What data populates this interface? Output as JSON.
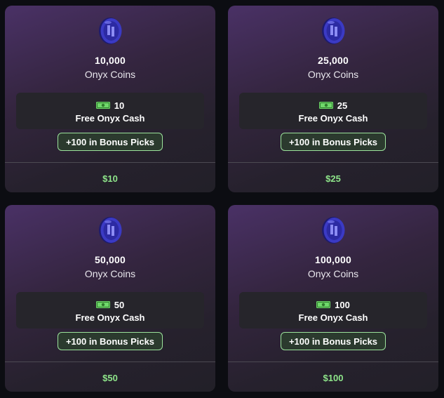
{
  "colors": {
    "background": "#0c0d12",
    "card_gradient_top": "#4a3166",
    "card_gradient_bottom": "#222028",
    "price_green": "#8ee58a",
    "pill_border": "#9ce39c",
    "coin_blue": "#3b3ac4"
  },
  "icons": {
    "coin": "onyx-coin-icon",
    "cash": "cash-bill-icon"
  },
  "packages": [
    {
      "amount": "10,000",
      "unit": "Onyx Coins",
      "cash_amount": "10",
      "cash_label": "Free Onyx Cash",
      "bonus_picks": "+100 in Bonus Picks",
      "price": "$10"
    },
    {
      "amount": "25,000",
      "unit": "Onyx Coins",
      "cash_amount": "25",
      "cash_label": "Free Onyx Cash",
      "bonus_picks": "+100 in Bonus Picks",
      "price": "$25"
    },
    {
      "amount": "50,000",
      "unit": "Onyx Coins",
      "cash_amount": "50",
      "cash_label": "Free Onyx Cash",
      "bonus_picks": "+100 in Bonus Picks",
      "price": "$50"
    },
    {
      "amount": "100,000",
      "unit": "Onyx Coins",
      "cash_amount": "100",
      "cash_label": "Free Onyx Cash",
      "bonus_picks": "+100 in Bonus Picks",
      "price": "$100"
    }
  ]
}
